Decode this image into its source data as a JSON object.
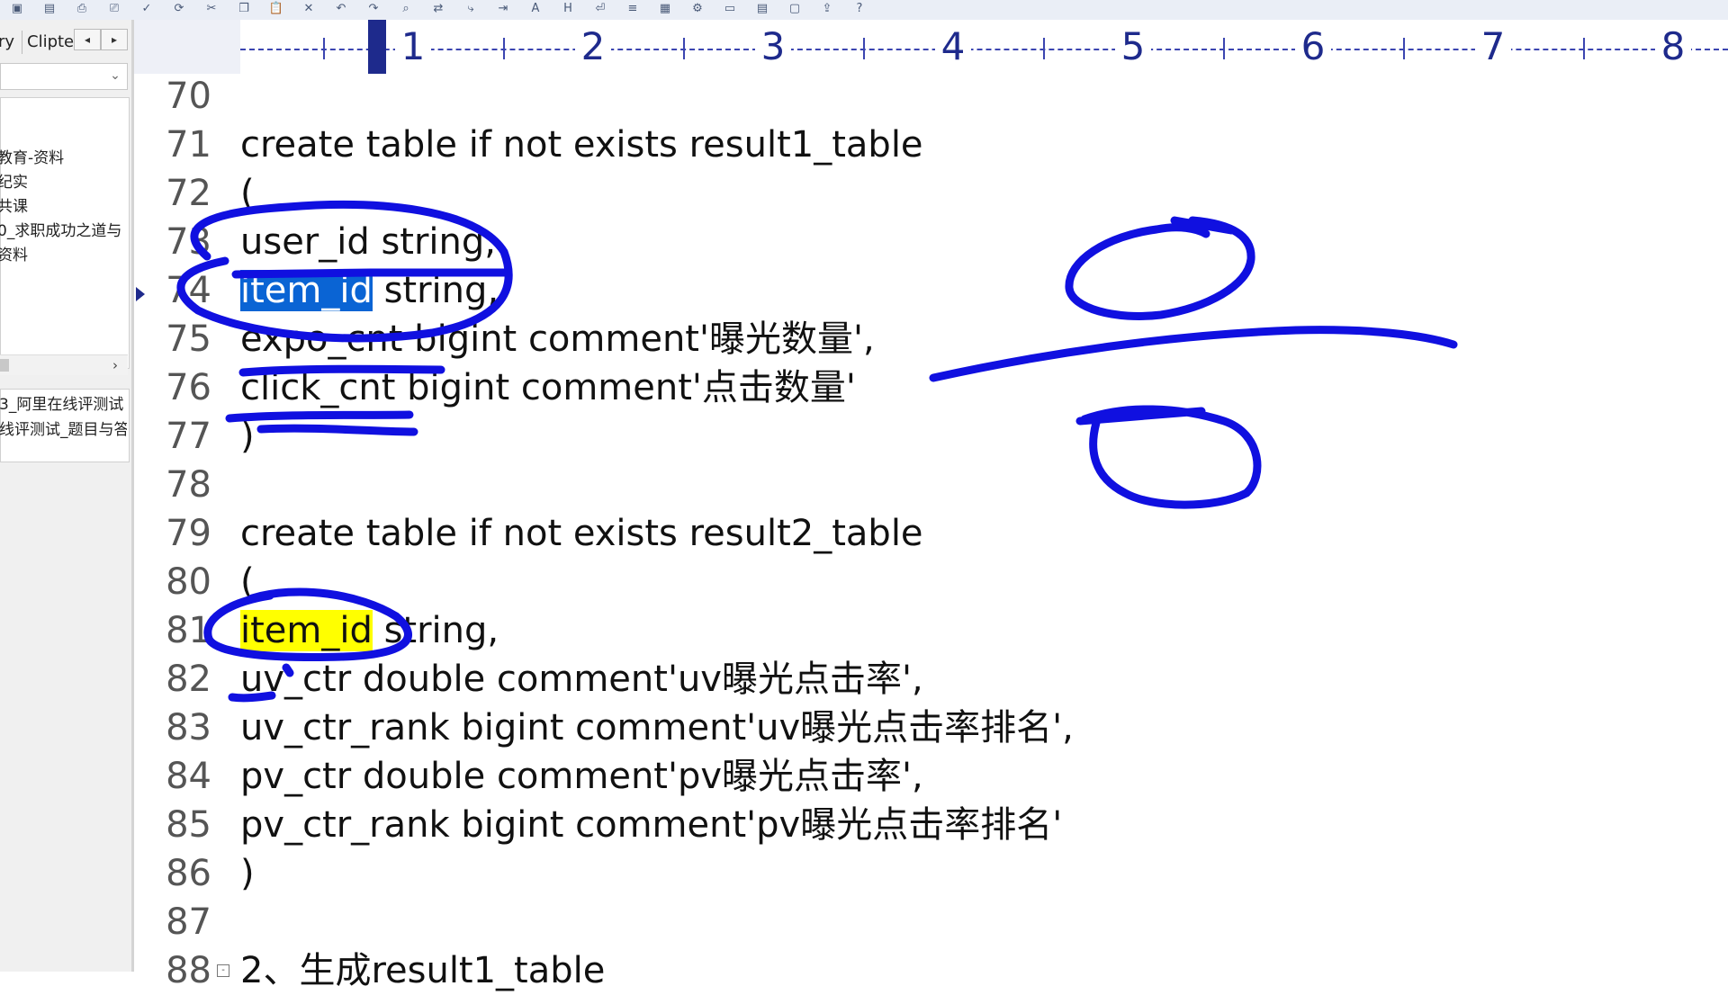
{
  "toolbar": {
    "icons": [
      "save-icon",
      "save-all-icon",
      "print-preview-icon",
      "print-icon",
      "spellcheck-icon",
      "reload-icon",
      "cut-icon",
      "copy-icon",
      "paste-icon",
      "delete-icon",
      "undo-icon",
      "redo-icon",
      "find-icon",
      "replace-icon",
      "goto-icon",
      "indent-icon",
      "font-icon",
      "hex-icon",
      "word-wrap-icon",
      "line-numbers-icon",
      "column-mode-icon",
      "settings-icon",
      "document-icon",
      "document-list-icon",
      "open-doc-icon",
      "export-icon",
      "help-icon"
    ]
  },
  "left_pane": {
    "tab_history": "ry",
    "tab_clipboard": "Clipte",
    "tab_prev": "◂",
    "tab_next": "▸",
    "dropdown_chevron": "⌄",
    "tree_items": [
      "教育-资料",
      "纪实",
      "共课",
      "求职成功之道与",
      "资料"
    ],
    "tree_item_prefix_4": "0",
    "scroll_right": "›",
    "lower_items": [
      "_阿里在线评测试",
      "线评测试_题目与答"
    ]
  },
  "ruler": {
    "numbers": [
      "1",
      "2",
      "3",
      "4",
      "5",
      "6",
      "7",
      "8"
    ]
  },
  "editor": {
    "lines": [
      {
        "n": "70",
        "text": ""
      },
      {
        "n": "71",
        "text": "create table if not exists result1_table"
      },
      {
        "n": "72",
        "text": "("
      },
      {
        "n": "73",
        "text": "user_id string,"
      },
      {
        "n": "74",
        "sel": "item_id",
        "rest": " string,"
      },
      {
        "n": "75",
        "text": "expo_cnt bigint comment'曝光数量',"
      },
      {
        "n": "76",
        "text": "click_cnt bigint comment'点击数量'"
      },
      {
        "n": "77",
        "text": ")"
      },
      {
        "n": "78",
        "text": ""
      },
      {
        "n": "79",
        "text": "create table if not exists result2_table"
      },
      {
        "n": "80",
        "text": "("
      },
      {
        "n": "81",
        "hl": "item_id",
        "rest": " string,"
      },
      {
        "n": "82",
        "text": "uv_ctr double comment'uv曝光点击率',"
      },
      {
        "n": "83",
        "text": "uv_ctr_rank bigint comment'uv曝光点击率排名',"
      },
      {
        "n": "84",
        "text": "pv_ctr double comment'pv曝光点击率',"
      },
      {
        "n": "85",
        "text": "pv_ctr_rank bigint comment'pv曝光点击率排名'"
      },
      {
        "n": "86",
        "text": ")"
      },
      {
        "n": "87",
        "text": ""
      },
      {
        "n": "88",
        "text": "2、生成result1_table",
        "fold": "-"
      }
    ]
  },
  "colors": {
    "selection": "#0a64d4",
    "highlight": "#ffff00",
    "ink": "#1010e0",
    "ruler_text": "#1e2a8c"
  }
}
